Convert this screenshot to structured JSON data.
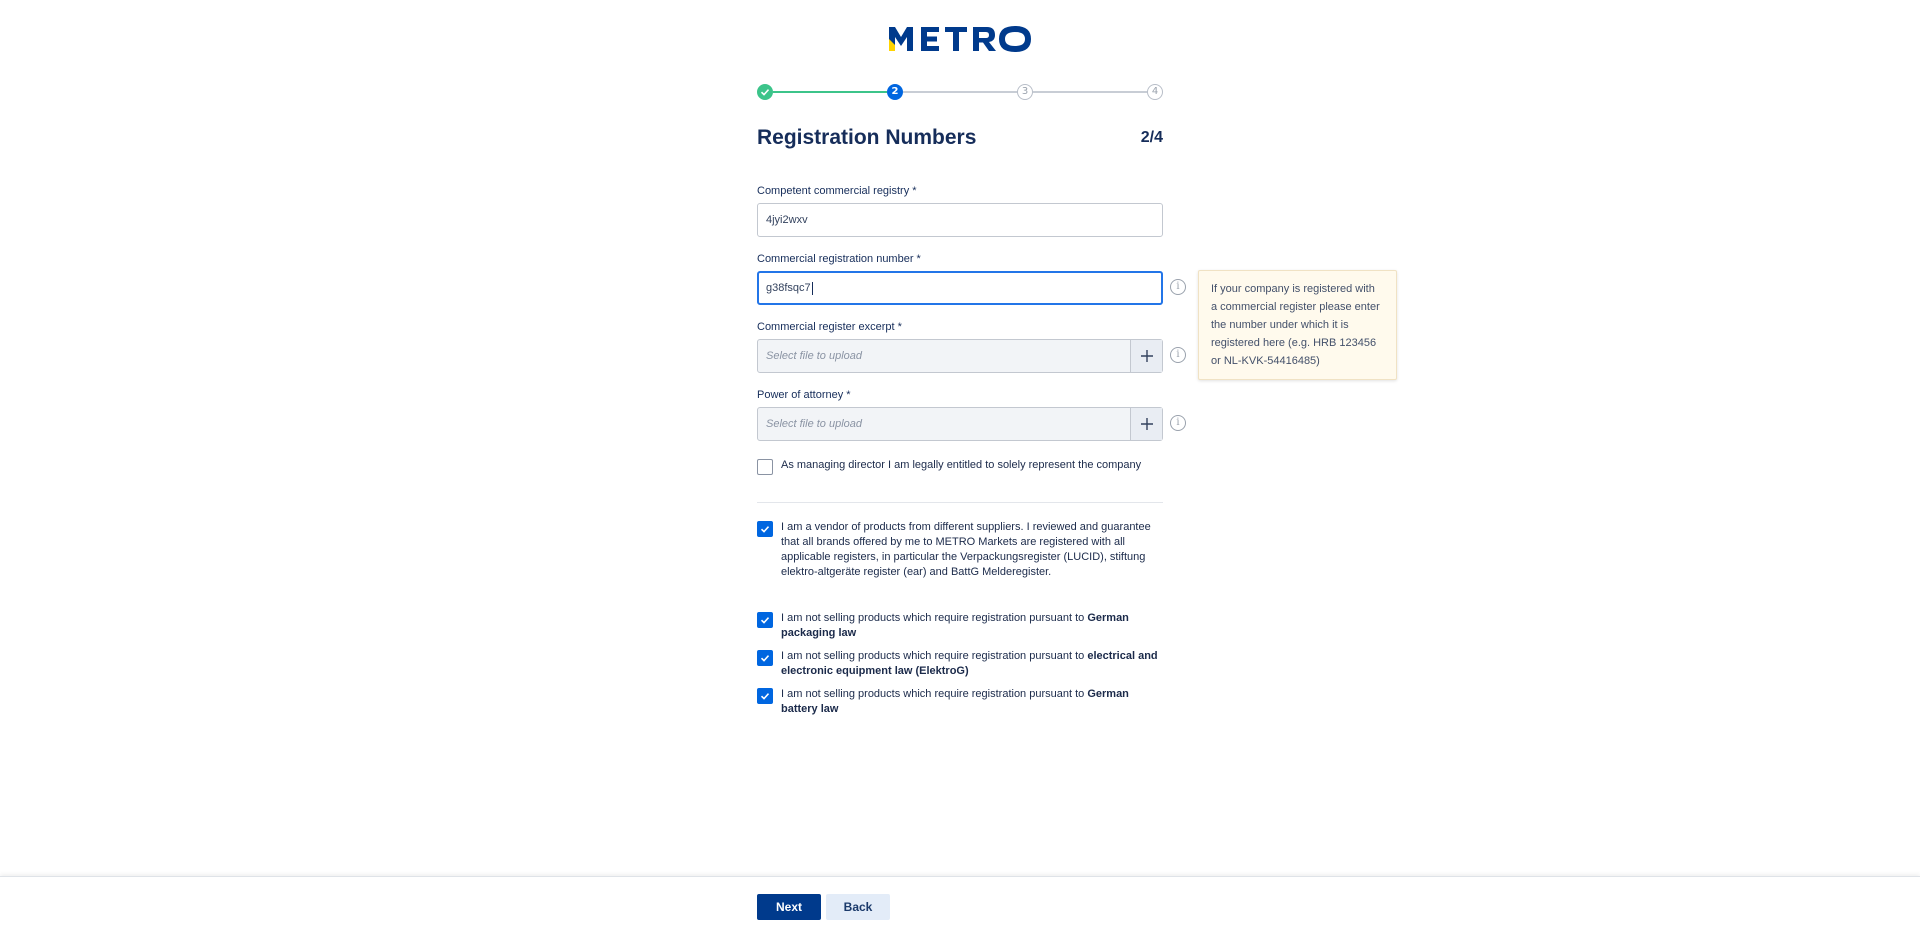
{
  "brand": {
    "logo_text": "METRO"
  },
  "stepper": {
    "steps": [
      {
        "number": "1",
        "state": "done"
      },
      {
        "number": "2",
        "state": "active"
      },
      {
        "number": "3",
        "state": "todo"
      },
      {
        "number": "4",
        "state": "todo"
      }
    ]
  },
  "page": {
    "title": "Registration Numbers",
    "step_count": "2/4"
  },
  "form": {
    "registry": {
      "label": "Competent commercial registry *",
      "value": "4jyi2wxv"
    },
    "reg_number": {
      "label": "Commercial registration number *",
      "value": "g38fsqc7"
    },
    "excerpt": {
      "label": "Commercial register excerpt *",
      "placeholder": "Select file to upload"
    },
    "attorney": {
      "label": "Power of attorney *",
      "placeholder": "Select file to upload"
    },
    "tooltip": "If your company is registered with a commercial register please enter the number under which it is registered here (e.g. HRB 123456 or NL-KVK-54416485)"
  },
  "checkboxes": {
    "managing_director": {
      "text": "As managing director I am legally entitled to solely represent the company",
      "checked": false
    },
    "vendor": {
      "text": "I am a vendor of products from different suppliers. I reviewed and guarantee that all brands offered by me to METRO Markets are registered with all applicable registers, in particular the Verpackungsregister (LUCID), stiftung elektro-altgeräte register (ear) and BattG Melderegister.",
      "checked": true
    },
    "packaging": {
      "prefix": "I am not selling products which require registration pursuant to ",
      "bold": "German packaging law",
      "checked": true
    },
    "electrical": {
      "prefix": "I am not selling products which require registration pursuant to ",
      "bold": "electrical and electronic equipment law (ElektroG)",
      "checked": true
    },
    "battery": {
      "prefix": "I am not selling products which require registration pursuant to ",
      "bold": "German battery law",
      "checked": true
    }
  },
  "footer": {
    "next_label": "Next",
    "back_label": "Back"
  },
  "colors": {
    "primary": "#0066e0",
    "navy": "#003a8c",
    "success": "#3cc48a",
    "logo_yellow": "#ffd400",
    "tooltip_bg": "#fffaed"
  },
  "icons": {
    "check": "check-icon",
    "plus": "plus-icon",
    "info": "info-icon"
  }
}
